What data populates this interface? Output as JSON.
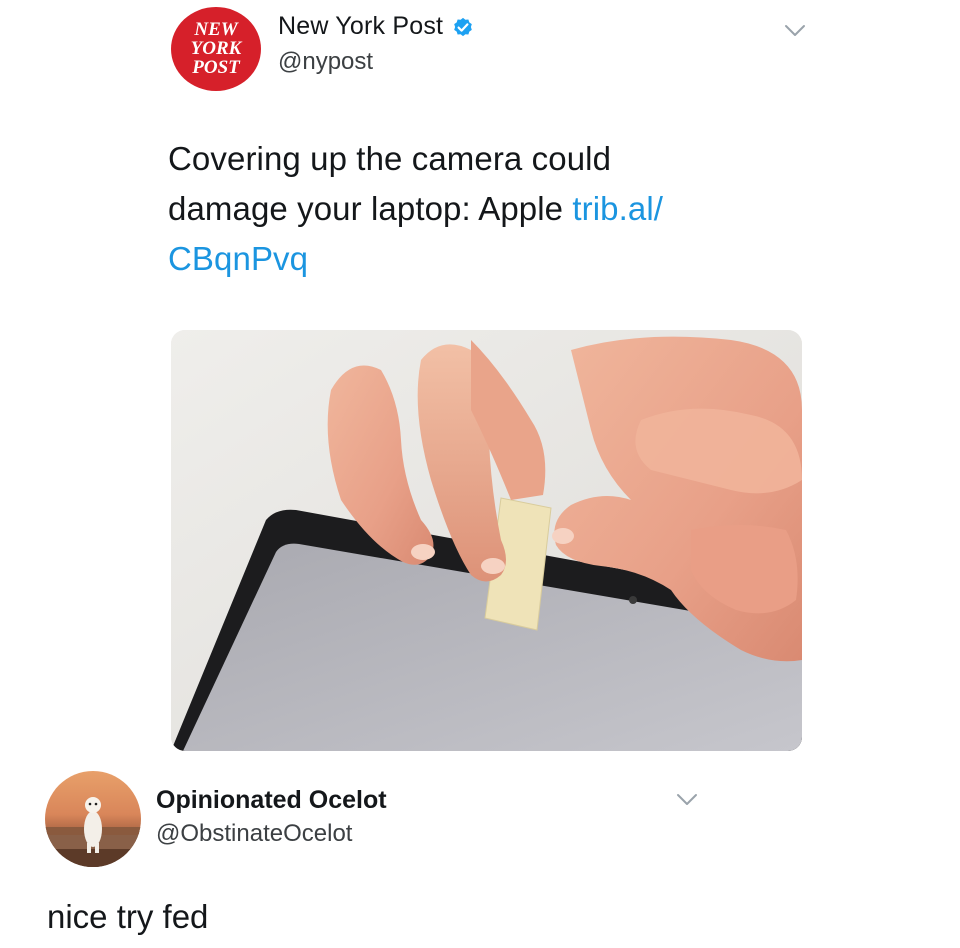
{
  "tweet": {
    "author": {
      "display_name": "New York Post",
      "handle": "@nypost",
      "verified": true,
      "avatar_logo_text": [
        "NEW",
        "YORK",
        "POST"
      ]
    },
    "text_plain": "Covering up the camera could damage your laptop: Apple ",
    "text_link_line1": "trib.al/",
    "text_link_line2": "CBqnPvq",
    "text_line1": "Covering up the camera could",
    "text_line2": "damage your laptop: Apple ",
    "media_description": "hands-covering-laptop-camera-with-tape",
    "menu_icon": "chevron-down-icon"
  },
  "reply": {
    "author": {
      "display_name": "Opinionated Ocelot",
      "handle": "@ObstinateOcelot"
    },
    "text": "nice try fed",
    "menu_icon": "chevron-down-icon"
  },
  "colors": {
    "link": "#1b95e0",
    "verified": "#1da1f2",
    "nyp_red": "#d6202a",
    "text": "#14171a",
    "secondary_text": "#3c4043"
  }
}
